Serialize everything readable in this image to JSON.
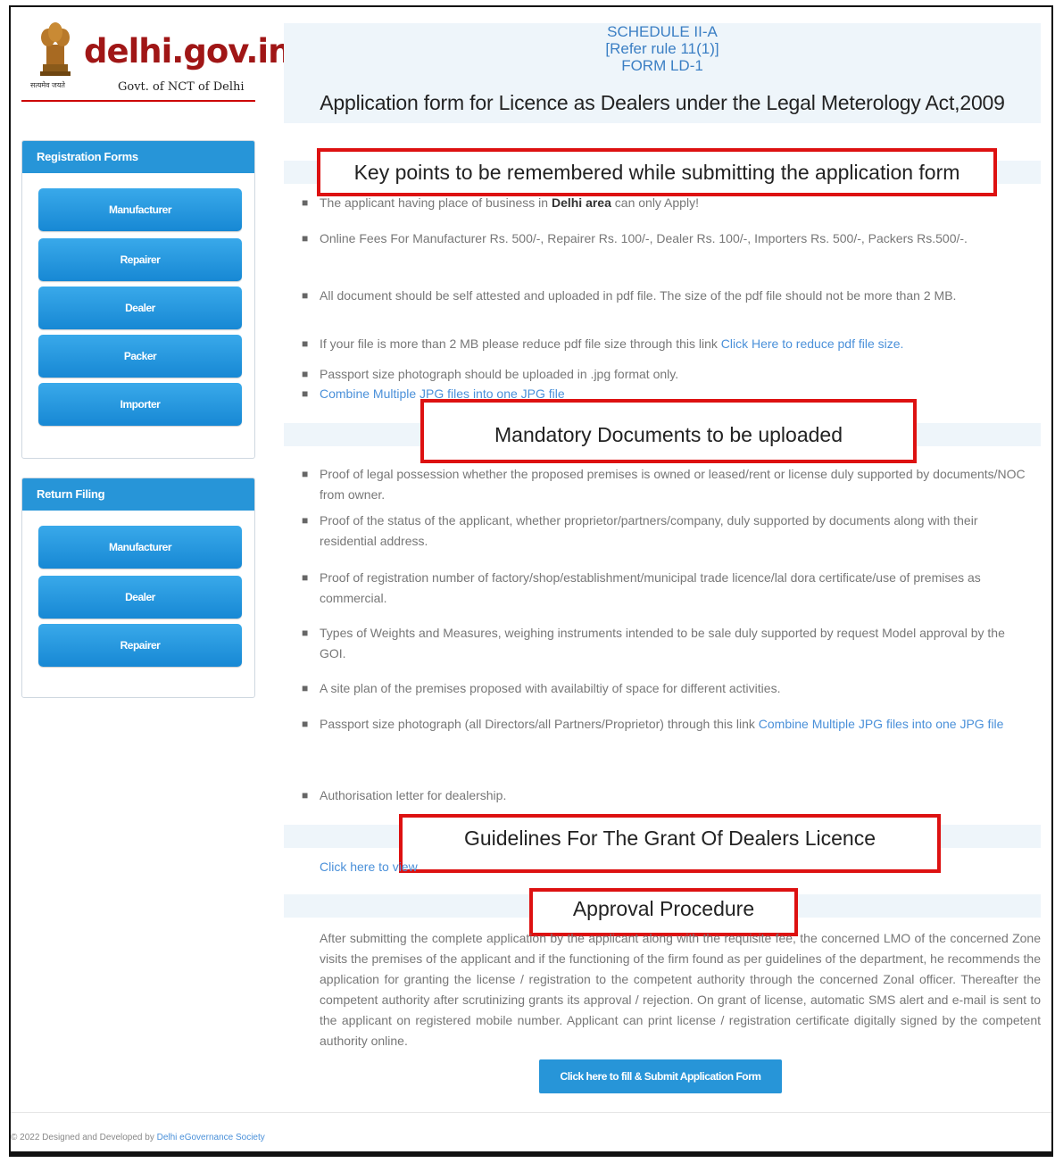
{
  "logo": {
    "text": "delhi.gov.in",
    "motto": "सत्यमेव जयते",
    "subtitle": "Govt. of NCT of Delhi"
  },
  "sidebar": {
    "registration": {
      "heading": "Registration Forms",
      "items": [
        "Manufacturer",
        "Repairer",
        "Dealer",
        "Packer",
        "Importer"
      ]
    },
    "return_filing": {
      "heading": "Return Filing",
      "items": [
        "Manufacturer",
        "Dealer",
        "Repairer"
      ]
    }
  },
  "header": {
    "schedule": "SCHEDULE II-A",
    "rule": "[Refer rule 11(1)]",
    "form": "FORM LD-1",
    "title": "Application form for Licence as Dealers under the Legal Meterology Act,2009"
  },
  "key_points": {
    "heading": "Key points to be remembered while submitting the application form",
    "p1_pre": "The applicant having place of business in ",
    "p1_bold": "Delhi area",
    "p1_post": " can only Apply!",
    "p2": "Online Fees For Manufacturer Rs. 500/-, Repairer Rs. 100/-, Dealer Rs. 100/-, Importers Rs. 500/-, Packers Rs.500/-.",
    "p3": "All document should be self attested and uploaded in pdf file. The size of the pdf file should not be more than 2 MB.",
    "p4_pre": "If your file is more than 2 MB please reduce pdf file size through this link ",
    "p4_link": "Click Here to reduce pdf file size.",
    "p5": "Passport size photograph should be uploaded in .jpg format only.",
    "p6_link": "Combine Multiple JPG files into one JPG file"
  },
  "mandatory": {
    "heading": "Mandatory Documents to be uploaded",
    "d1": "Proof of legal possession whether the proposed premises is owned or leased/rent or license duly supported by documents/NOC from owner.",
    "d2": "Proof of the status of the applicant, whether proprietor/partners/company, duly supported by documents along with their residential address.",
    "d3": "Proof of registration number of factory/shop/establishment/municipal trade licence/lal dora certificate/use of premises as commercial.",
    "d4": "Types of Weights and Measures, weighing instruments intended to be sale duly supported by request Model approval by the GOI.",
    "d5": "A site plan of the premises proposed with availabiltiy of space for different activities.",
    "d6_pre": "Passport size photograph (all Directors/all Partners/Proprietor) through this link ",
    "d6_link": "Combine Multiple JPG files into one JPG file",
    "d7": "Authorisation letter for dealership."
  },
  "guidelines": {
    "heading": "Guidelines For The Grant Of Dealers Licence",
    "link": "Click here to view"
  },
  "approval": {
    "heading": "Approval Procedure",
    "text": "After submitting the complete application by the applicant along with the requisite fee, the concerned LMO of the concerned Zone visits the premises of the applicant and if the functioning of the firm found as per guidelines of the department, he recommends the application for granting the license / registration to the competent authority through the concerned Zonal officer. Thereafter the competent authority after scrutinizing grants its approval / rejection. On grant of license, automatic SMS alert and e-mail is sent to the applicant on registered mobile number. Applicant can print license / registration certificate digitally signed by the competent authority online.",
    "button": "Click here to fill & Submit Application Form"
  },
  "footer": {
    "text": "© 2022 Designed and Developed by ",
    "link": "Delhi eGovernance Society"
  }
}
